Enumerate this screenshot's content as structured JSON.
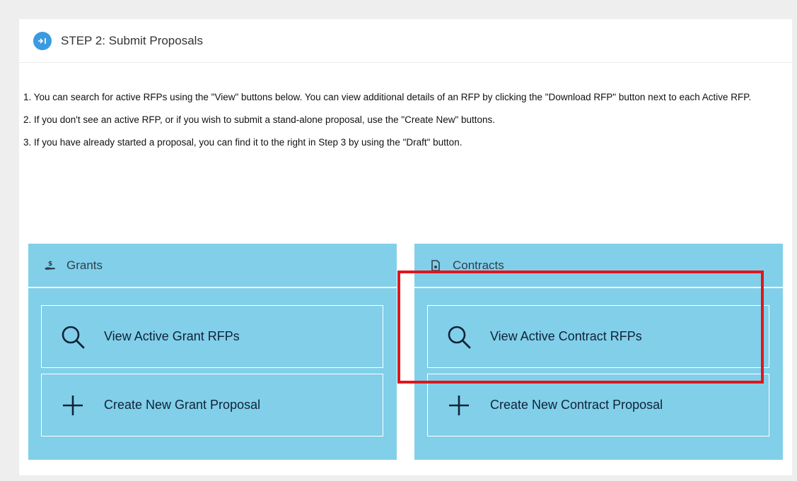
{
  "step": {
    "icon": "step-arrow-icon",
    "title": "STEP 2: Submit Proposals"
  },
  "instructions": [
    "1. You can search for active RFPs using the \"View\" buttons below. You can view additional details of an RFP by clicking the \"Download RFP\" button next to each Active RFP.",
    "2. If you don't see an active RFP, or if you wish to submit a stand-alone proposal, use the \"Create New\" buttons.",
    "3. If you have already started a proposal, you can find it to the right in Step 3 by using the \"Draft\" button."
  ],
  "grants": {
    "title": "Grants",
    "icon": "hand-money-icon",
    "view_label": "View Active Grant RFPs",
    "create_label": "Create New Grant Proposal"
  },
  "contracts": {
    "title": "Contracts",
    "icon": "document-icon",
    "view_label": "View Active Contract RFPs",
    "create_label": "Create New Contract Proposal"
  },
  "colors": {
    "card_bg": "#82cfe9",
    "highlight": "#e0161b",
    "step_icon": "#3a9be0"
  }
}
